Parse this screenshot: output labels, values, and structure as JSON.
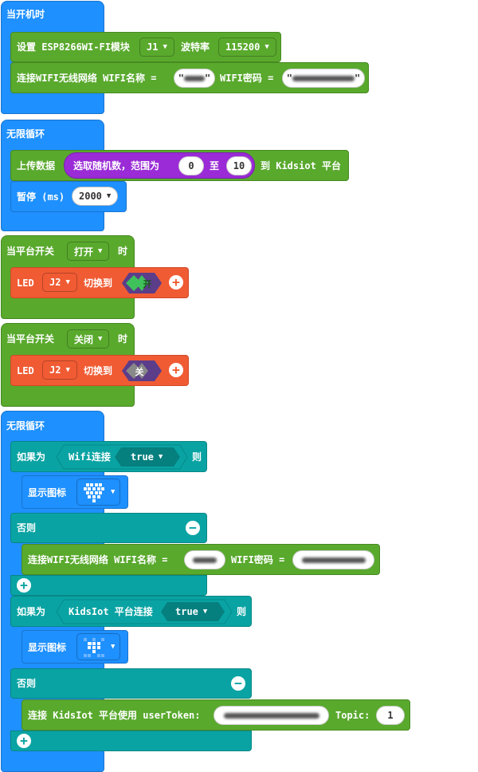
{
  "colors": {
    "blue": "#1e90ff",
    "green": "#59a92d",
    "orange": "#f05b33",
    "teal": "#0aa3a3",
    "purple": "#9a2bd6"
  },
  "block1": {
    "hat": "当开机时",
    "setup_prefix": "设置 ESP8266WI-FI模块",
    "module_pin": "J1",
    "baud_label": "波特率",
    "baud_value": "115200",
    "connect_label": "连接WIFI无线网络 WIFI名称 =",
    "ssid_quote": "\"",
    "pwd_label": "WIFI密码 ="
  },
  "block2": {
    "hat": "无限循环",
    "upload_label": "上传数据",
    "random_label": "选取随机数，范围为",
    "random_min": "0",
    "to_label": "至",
    "random_max": "10",
    "platform_label": "到 Kidsiot 平台",
    "pause_label": "暂停 (ms)",
    "pause_value": "2000"
  },
  "block3": {
    "hat_prefix": "当平台开关",
    "switch_value": "打开",
    "hat_suffix": "时",
    "led_label": "LED",
    "led_pin": "J2",
    "switch_to": "切换到",
    "state": "开"
  },
  "block4": {
    "hat_prefix": "当平台开关",
    "switch_value": "关闭",
    "hat_suffix": "时",
    "led_label": "LED",
    "led_pin": "J2",
    "switch_to": "切换到",
    "state": "关"
  },
  "block5": {
    "hat": "无限循环",
    "if_label": "如果为",
    "wifi_conn": "Wifi连接",
    "true_value": "true",
    "then_label": "则",
    "show_icon": "显示图标",
    "else_label": "否则",
    "connect_label": "连接WIFI无线网络 WIFI名称 =",
    "pwd_label": "WIFI密码 =",
    "if2_label": "如果为",
    "kidsiot_conn": "KidsIot 平台连接",
    "true2_value": "true",
    "then2_label": "则",
    "show_icon2": "显示图标",
    "else2_label": "否则",
    "kidsiot_connect": "连接 KidsIot 平台使用 userToken:",
    "topic_label": "Topic:",
    "topic_value": "1"
  }
}
